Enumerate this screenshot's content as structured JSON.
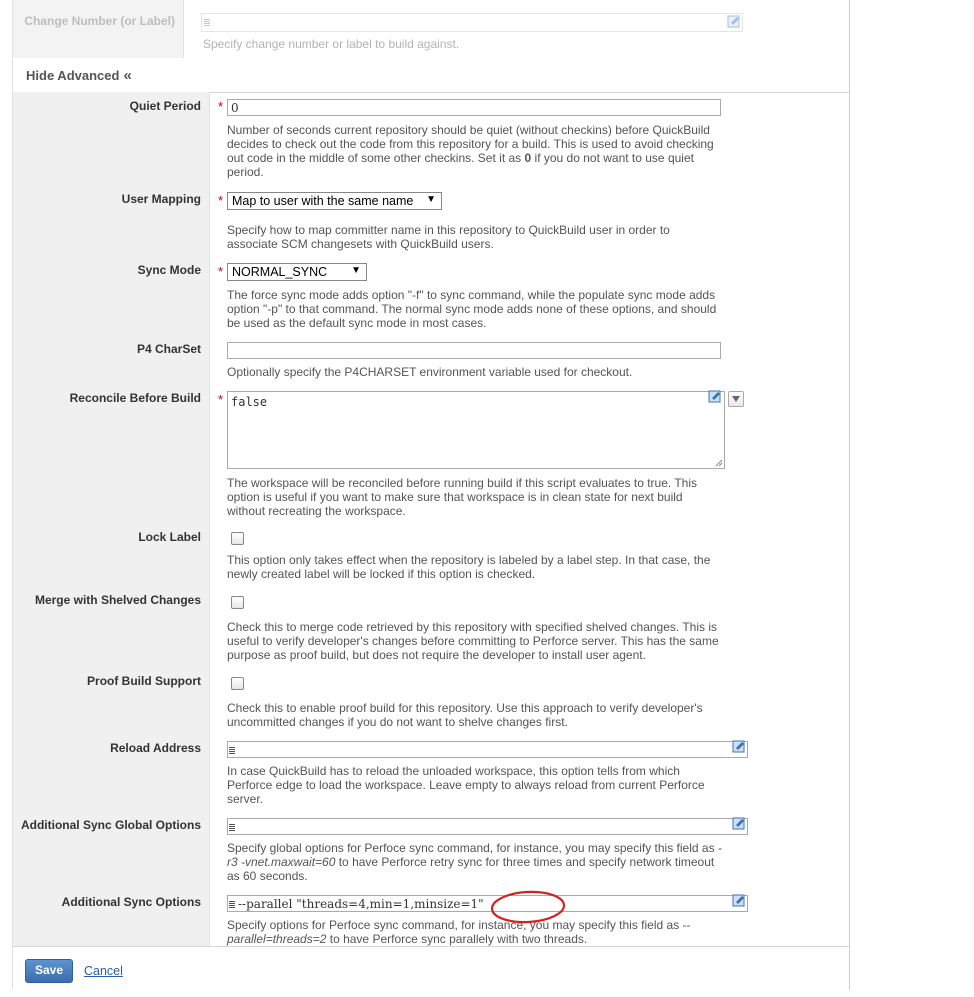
{
  "top": {
    "label": "Change Number (or Label)",
    "help": "Specify change number or label to build against."
  },
  "toggle": {
    "label": "Hide Advanced",
    "glyph": "«"
  },
  "fields": {
    "quiet_period": {
      "label": "Quiet Period",
      "value": "0",
      "help_pre": "Number of seconds current repository should be quiet (without checkins) before QuickBuild decides to check out the code from this repository for a build. This is used to avoid checking out code in the middle of some other checkins. Set it as ",
      "help_bold": "0",
      "help_post": " if you do not want to use quiet period."
    },
    "user_mapping": {
      "label": "User Mapping",
      "value": "Map to user with the same name",
      "help": "Specify how to map committer name in this repository to QuickBuild user in order to associate SCM changesets with QuickBuild users."
    },
    "sync_mode": {
      "label": "Sync Mode",
      "value": "NORMAL_SYNC",
      "help": "The force sync mode adds option \"-f\" to sync command, while the populate sync mode adds option \"-p\" to that command. The normal sync mode adds none of these options, and should be used as the default sync mode in most cases."
    },
    "p4_charset": {
      "label": "P4 CharSet",
      "value": "",
      "help": "Optionally specify the P4CHARSET environment variable used for checkout."
    },
    "reconcile": {
      "label": "Reconcile Before Build",
      "value": "false",
      "help": "The workspace will be reconciled before running build if this script evaluates to true. This option is useful if you want to make sure that workspace is in clean state for next build without recreating the workspace."
    },
    "lock_label": {
      "label": "Lock Label",
      "help": "This option only takes effect when the repository is labeled by a label step. In that case, the newly created label will be locked if this option is checked."
    },
    "merge_shelved": {
      "label": "Merge with Shelved Changes",
      "help": "Check this to merge code retrieved by this repository with specified shelved changes. This is useful to verify developer's changes before committing to Perforce server. This has the same purpose as proof build, but does not require the developer to install user agent."
    },
    "proof_build": {
      "label": "Proof Build Support",
      "help": "Check this to enable proof build for this repository. Use this approach to verify developer's uncommitted changes if you do not want to shelve changes first."
    },
    "reload_address": {
      "label": "Reload Address",
      "value": "",
      "help": "In case QuickBuild has to reload the unloaded workspace, this option tells from which Perforce edge to load the workspace. Leave empty to always reload from current Perforce server."
    },
    "global_options": {
      "label": "Additional Sync Global Options",
      "value": "",
      "help_pre": "Specify global options for Perfoce sync command, for instance, you may specify this field as ",
      "help_em": "-r3 -vnet.maxwait=60",
      "help_post": " to have Perforce retry sync for three times and specify network timeout as 60 seconds."
    },
    "sync_options": {
      "label": "Additional Sync Options",
      "value": "--parallel \"threads=4,min=1,minsize=1\"",
      "help_pre": "Specify options for Perfoce sync command, for instance, you may specify this field as --",
      "help_em": "parallel=threads=2",
      "help_post": " to have Perforce sync parallely with two threads."
    }
  },
  "footer": {
    "save": "Save",
    "cancel": "Cancel"
  },
  "colors": {
    "required": "#dd0000",
    "save_button": "#3a6db0",
    "annotation": "#d42020"
  },
  "icons": [
    "edit-icon",
    "lines-icon",
    "dropdown-arrow-icon",
    "checkbox"
  ]
}
